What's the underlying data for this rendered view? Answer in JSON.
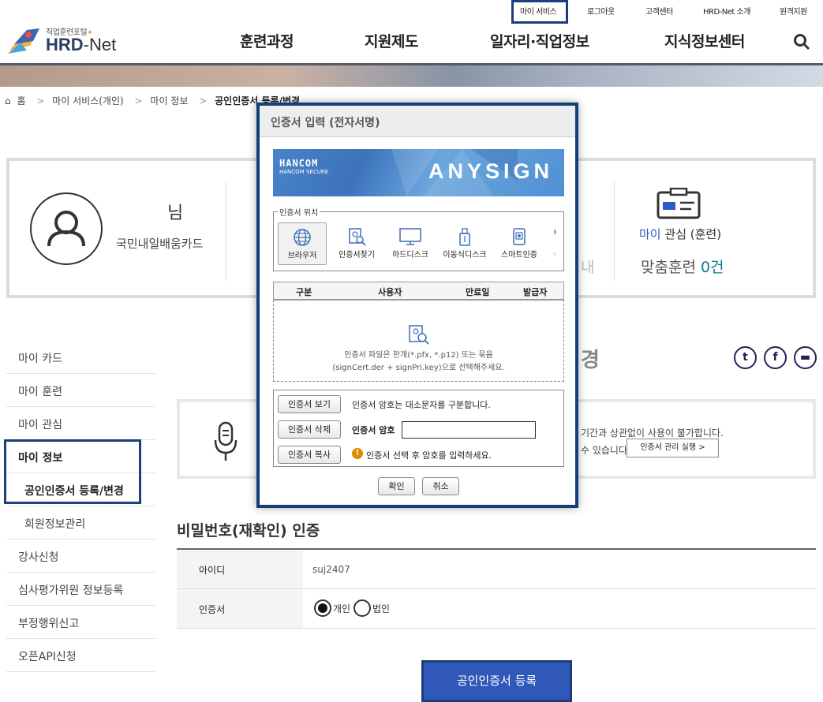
{
  "utility_nav": [
    "마이 서비스",
    "로그아웃",
    "고객센터",
    "HRD-Net 소개",
    "원격지원"
  ],
  "logo": {
    "subtitle": "직업훈련포털",
    "name_bold": "HRD",
    "name_rest": "-Net"
  },
  "gnb": [
    "훈련과정",
    "지원제도",
    "일자리·직업정보",
    "지식정보센터"
  ],
  "breadcrumb": {
    "home": "홈",
    "items": [
      "마이 서비스(개인)",
      "마이 정보"
    ],
    "current": "공인인증서 등록/변경"
  },
  "profile": {
    "honorific": "님",
    "card": "국민내일배움카드",
    "fav_prefix": "마이",
    "fav_title": "관심 (훈련)",
    "fav_label": "맞춤훈련",
    "fav_count": "0건",
    "ghost": "내"
  },
  "lnb": [
    "마이 카드",
    "마이 훈련",
    "마이 관심",
    "마이 정보",
    "공인인증서 등록/변경",
    "회원정보관리",
    "강사신청",
    "심사평가위원 정보등록",
    "부정행위신고",
    "오픈API신청"
  ],
  "page_title_ghost": "경",
  "notice": {
    "line1": "기간과 상관없이 사용이 불가합니다.",
    "line2": "수 있습니다.",
    "button": "인증서 관리 실행 >"
  },
  "password_section": {
    "title": "비밀번호(재확인) 인증",
    "id_label": "아이디",
    "id_value": "suj2407",
    "cert_label": "인증서",
    "radio_personal": "개인",
    "radio_corporate": "법인"
  },
  "submit_label": "공인인증서 등록",
  "dialog": {
    "title": "인증서 입력 (전자서명)",
    "banner": {
      "brand": "HANCOM",
      "brand_sub": "HANCOM SECURE",
      "product": "ANYSIGN"
    },
    "location_legend": "인증서 위치",
    "locations": [
      "브라우저",
      "인증서찾기",
      "하드디스크",
      "이동식디스크",
      "스마트인증"
    ],
    "table_headers": [
      "구분",
      "사용자",
      "만료일",
      "발급자"
    ],
    "drop_line1": "인증서 파일은 한개(*.pfx, *.p12) 또는 묶음",
    "drop_line2": "(signCert.der + signPri.key)으로 선택해주세요.",
    "btn_view": "인증서 보기",
    "btn_delete": "인증서 삭제",
    "btn_copy": "인증서 복사",
    "case_notice": "인증서 암호는 대소문자를 구분합니다.",
    "pw_label": "인증서 암호",
    "warn_text": "인증서 선택 후 암호를 입력하세요.",
    "ok": "확인",
    "cancel": "취소"
  },
  "colors": {
    "accent": "#1b3f7a",
    "button": "#3058b8",
    "banner": "#4a83c8"
  }
}
